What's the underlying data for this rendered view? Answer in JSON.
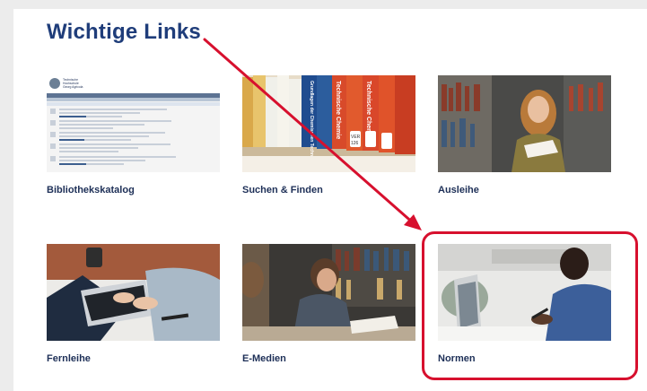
{
  "section": {
    "title": "Wichtige Links"
  },
  "links": [
    {
      "label": "Bibliothekskatalog",
      "thumb": "catalog-screenshot"
    },
    {
      "label": "Suchen & Finden",
      "thumb": "book-spines"
    },
    {
      "label": "Ausleihe",
      "thumb": "woman-with-book"
    },
    {
      "label": "Fernleihe",
      "thumb": "laptop-typing"
    },
    {
      "label": "E-Medien",
      "thumb": "students-library"
    },
    {
      "label": "Normen",
      "thumb": "man-writing"
    }
  ],
  "catalog_thumb": {
    "logo_lines": [
      "Technische",
      "Hochschule",
      "Georg Agricola"
    ],
    "book_titles": [
      "Technische Chemie",
      "Technische Chemie",
      "Grundlagen der Chemischen Technik",
      "VER",
      "126"
    ]
  },
  "annotation": {
    "highlight_color": "#d7102e",
    "highlighted": "Normen"
  }
}
